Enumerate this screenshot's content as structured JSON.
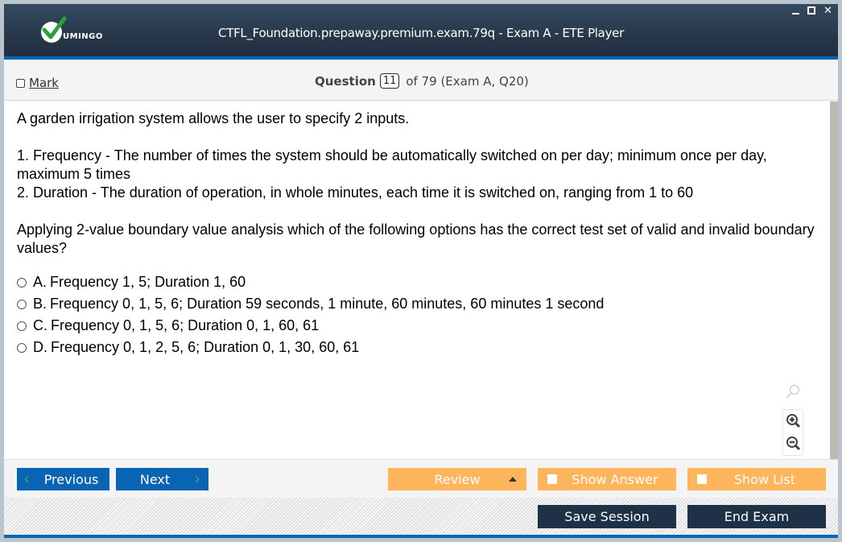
{
  "window": {
    "title": "CTFL_Foundation.prepaway.premium.exam.79q - Exam A - ETE Player",
    "logo_text": "UMINGO",
    "controls": {
      "minimize": "minimize-icon",
      "maximize": "maximize-icon",
      "close": "close-icon"
    }
  },
  "question_bar": {
    "mark_label": "Mark",
    "mark_checked": false,
    "question_label": "Question",
    "question_number": "11",
    "question_suffix": "of 79 (Exam A, Q20)"
  },
  "question": {
    "paragraphs": [
      "A garden irrigation system allows the user to specify 2 inputs.",
      "",
      "1. Frequency - The number of times the system should be automatically switched on per day; minimum once per day, maximum 5 times",
      "2. Duration - The duration of operation, in whole minutes, each time it is switched on, ranging from 1 to 60",
      "",
      "Applying 2-value boundary value analysis which of the following options has the correct test set of valid and invalid boundary values?"
    ],
    "options": [
      {
        "letter": "A.",
        "text": "Frequency 1, 5; Duration 1, 60",
        "selected": false
      },
      {
        "letter": "B.",
        "text": "Frequency 0, 1, 5, 6; Duration 59 seconds, 1 minute, 60 minutes, 60 minutes 1 second",
        "selected": false
      },
      {
        "letter": "C.",
        "text": "Frequency 0, 1, 5, 6; Duration 0, 1, 60, 61",
        "selected": false
      },
      {
        "letter": "D.",
        "text": "Frequency 0, 1, 2, 5, 6; Duration 0, 1, 30, 60, 61",
        "selected": false
      }
    ]
  },
  "zoom_tools": {
    "reset": "magnifier-icon",
    "zoom_in": "zoom-in-icon",
    "zoom_out": "zoom-out-icon"
  },
  "nav": {
    "previous_label": "Previous",
    "next_label": "Next",
    "review_label": "Review",
    "show_answer_label": "Show Answer",
    "show_list_label": "Show List"
  },
  "footer": {
    "save_session_label": "Save Session",
    "end_exam_label": "End Exam"
  },
  "colors": {
    "primary_blue": "#0a64b4",
    "orange": "#ffb55c",
    "dark_navy": "#1e3147",
    "chevron_green": "#46a64a"
  }
}
